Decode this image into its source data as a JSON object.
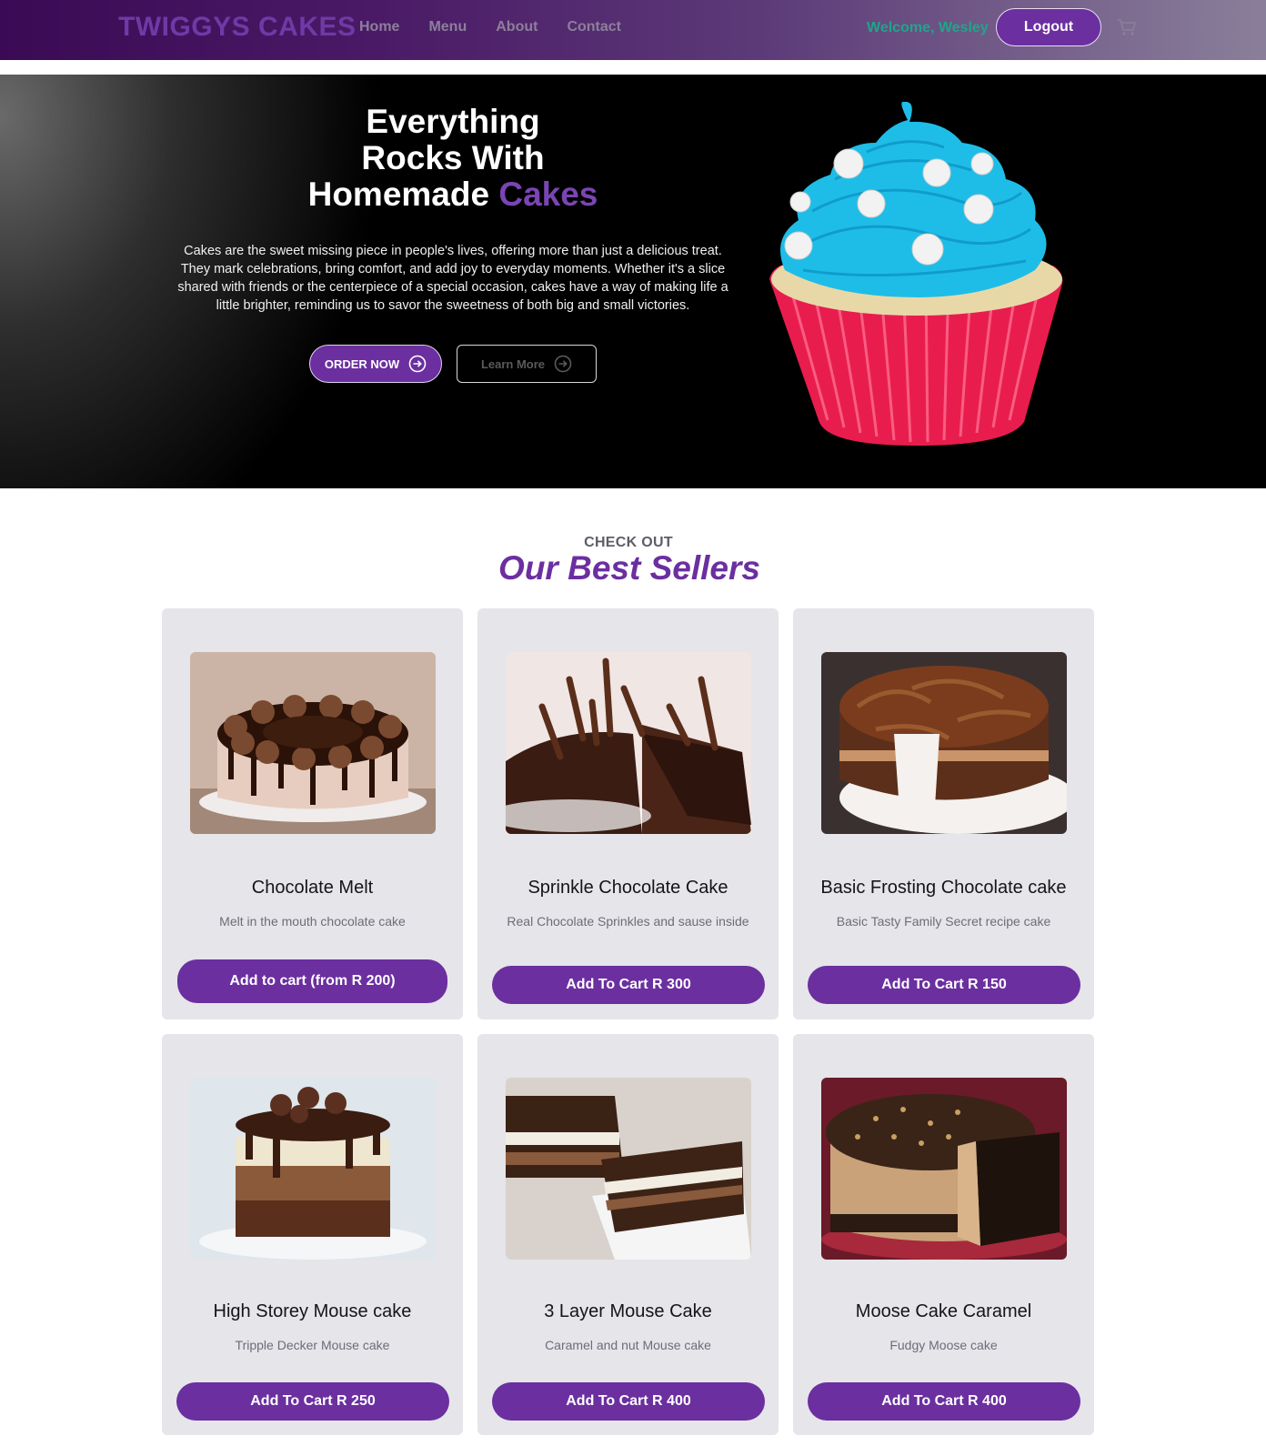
{
  "navbar": {
    "brand": "TWIGGYS CAKES",
    "links": [
      "Home",
      "Menu",
      "About",
      "Contact"
    ],
    "welcome": "Welcome, Wesley",
    "logout_label": "Logout",
    "cart_icon": "cart-icon"
  },
  "hero": {
    "title_line1": "Everything",
    "title_line2": "Rocks With",
    "title_line3_prefix": "Homemade ",
    "title_line3_accent": "Cakes",
    "description": "Cakes are the sweet missing piece in people's lives, offering more than just a delicious treat. They mark celebrations, bring comfort, and add joy to everyday moments. Whether it's a slice shared with friends or the centerpiece of a special occasion, cakes have a way of making life a little brighter, reminding us to savor the sweetness of both big and small victories.",
    "order_label": "ORDER NOW",
    "learn_label": "Learn More"
  },
  "bestsellers": {
    "kicker": "CHECK OUT",
    "title": "Our Best Sellers",
    "products": [
      {
        "name": "Chocolate Melt",
        "desc": "Melt in the mouth chocolate cake",
        "button": "Add to cart (from R 200)"
      },
      {
        "name": "Sprinkle Chocolate Cake",
        "desc": "Real Chocolate Sprinkles and sause inside",
        "button": "Add To Cart R 300"
      },
      {
        "name": "Basic Frosting Chocolate cake",
        "desc": "Basic Tasty Family Secret recipe cake",
        "button": "Add To Cart R 150"
      },
      {
        "name": "High Storey Mouse cake",
        "desc": "Tripple Decker Mouse cake",
        "button": "Add To Cart R 250"
      },
      {
        "name": "3 Layer Mouse Cake",
        "desc": "Caramel and nut Mouse cake",
        "button": "Add To Cart R 400"
      },
      {
        "name": "Moose Cake Caramel",
        "desc": "Fudgy Moose cake",
        "button": "Add To Cart R 400"
      }
    ]
  },
  "colors": {
    "accent": "#6b2fa0",
    "welcome": "#1fa58a",
    "card_bg": "#e5e5ea"
  }
}
